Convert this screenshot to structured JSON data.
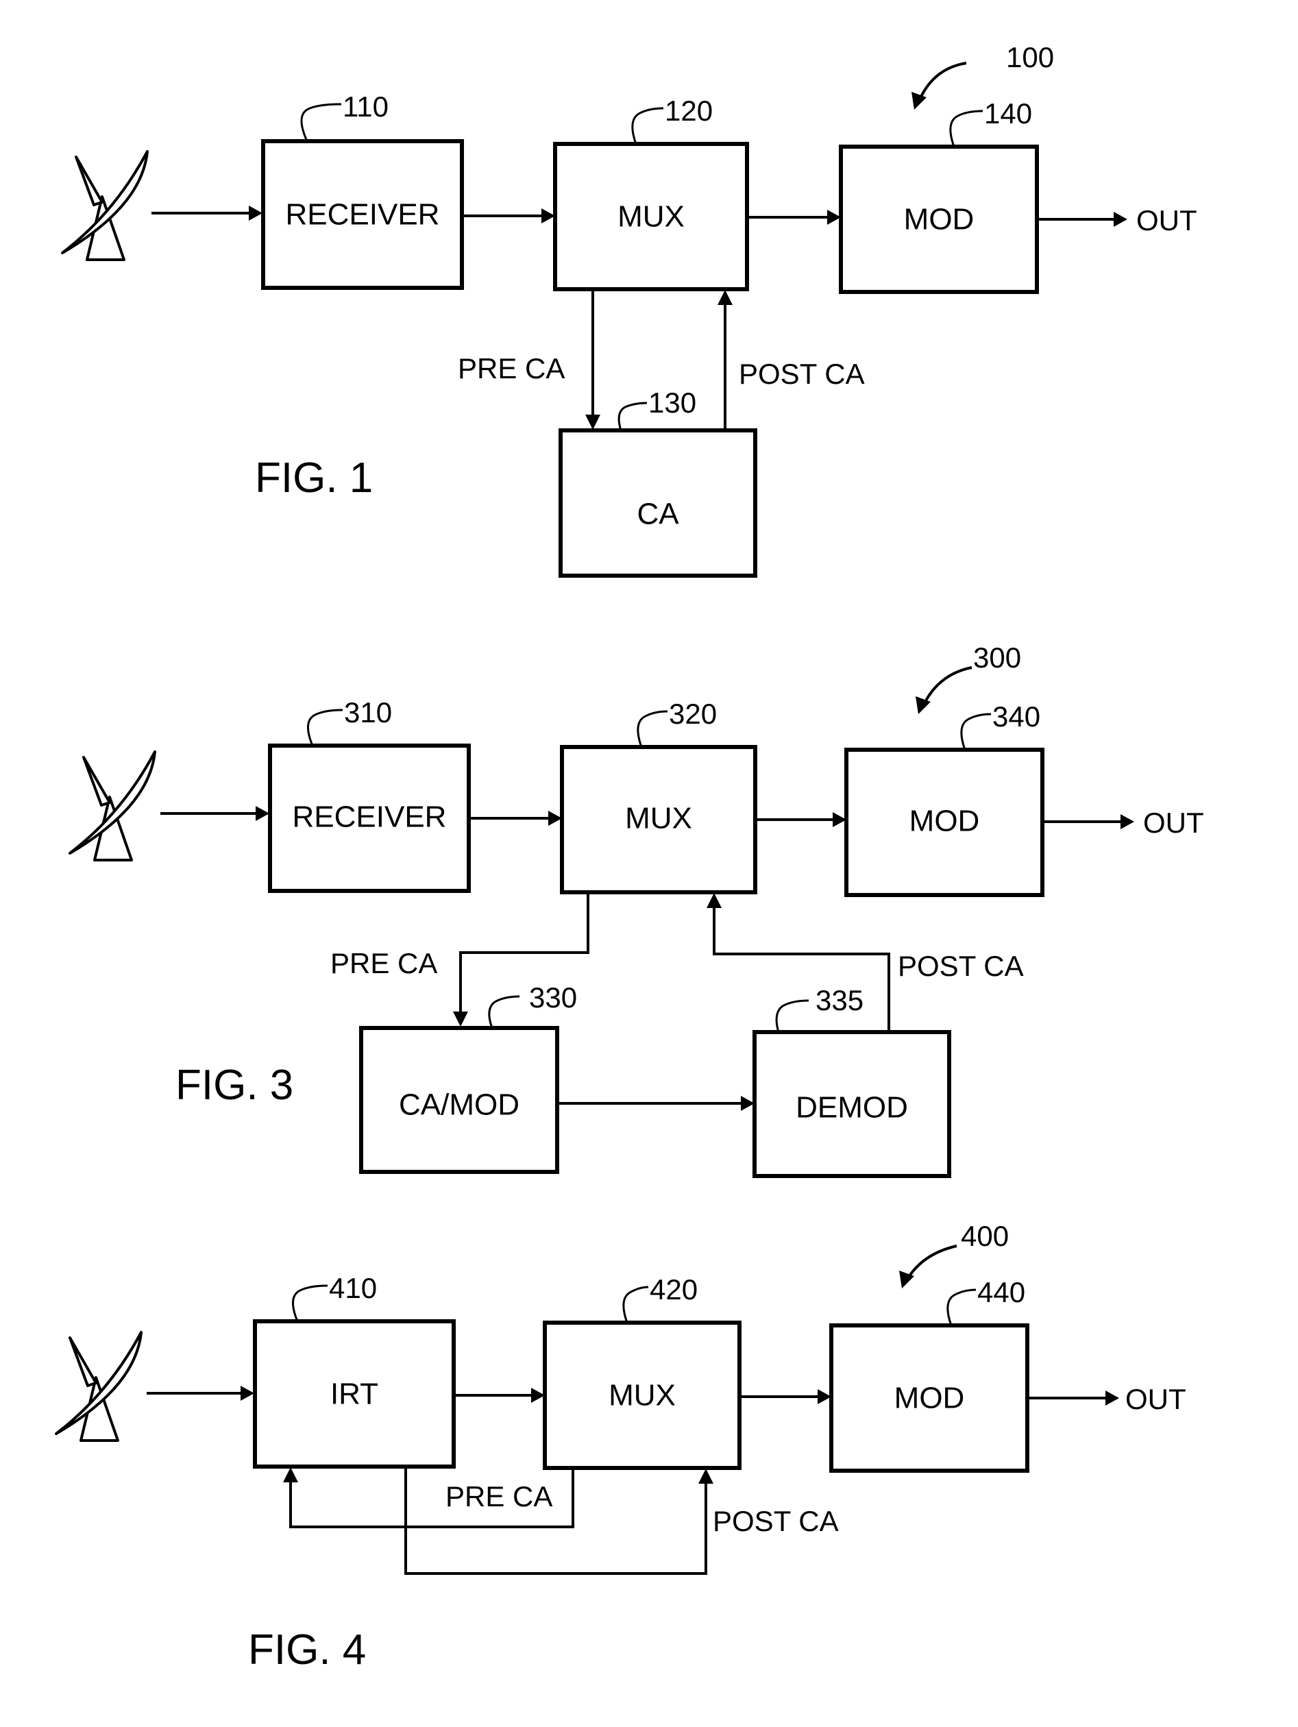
{
  "figures": [
    {
      "caption": "FIG. 1",
      "system_ref": "100",
      "blocks": {
        "receiver": {
          "label": "RECEIVER",
          "ref": "110"
        },
        "mux": {
          "label": "MUX",
          "ref": "120"
        },
        "mod": {
          "label": "MOD",
          "ref": "140"
        },
        "ca": {
          "label": "CA",
          "ref": "130"
        }
      },
      "signals": {
        "pre": "PRE CA",
        "post": "POST CA",
        "out": "OUT"
      },
      "icons": {
        "antenna": "satellite-dish-icon"
      }
    },
    {
      "caption": "FIG. 3",
      "system_ref": "300",
      "blocks": {
        "receiver": {
          "label": "RECEIVER",
          "ref": "310"
        },
        "mux": {
          "label": "MUX",
          "ref": "320"
        },
        "mod": {
          "label": "MOD",
          "ref": "340"
        },
        "camod": {
          "label": "CA/MOD",
          "ref": "330"
        },
        "demod": {
          "label": "DEMOD",
          "ref": "335"
        }
      },
      "signals": {
        "pre": "PRE CA",
        "post": "POST CA",
        "out": "OUT"
      },
      "icons": {
        "antenna": "satellite-dish-icon"
      }
    },
    {
      "caption": "FIG. 4",
      "system_ref": "400",
      "blocks": {
        "irt": {
          "label": "IRT",
          "ref": "410"
        },
        "mux": {
          "label": "MUX",
          "ref": "420"
        },
        "mod": {
          "label": "MOD",
          "ref": "440"
        }
      },
      "signals": {
        "pre": "PRE CA",
        "post": "POST CA",
        "out": "OUT"
      },
      "icons": {
        "antenna": "satellite-dish-icon"
      }
    }
  ]
}
